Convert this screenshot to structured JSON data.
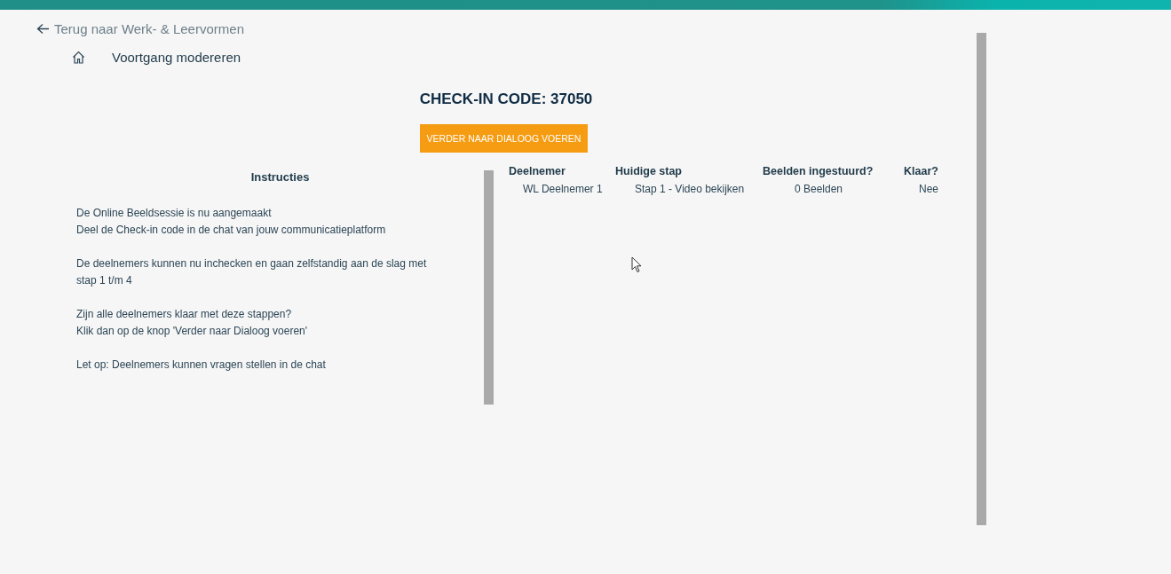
{
  "back_link": {
    "label": "Terug naar Werk- & Leervormen"
  },
  "header": {
    "title": "Voortgang modereren"
  },
  "check_in": {
    "title": "CHECK-IN CODE: 37050"
  },
  "primary_button": {
    "label": "VERDER NAAR DIALOOG VOEREN"
  },
  "instructions": {
    "title": "Instructies",
    "paragraphs": [
      [
        "De Online Beeldsessie is nu aangemaakt",
        "Deel de Check-in code in de chat van jouw communicatieplatform"
      ],
      [
        "De deelnemers kunnen nu inchecken en gaan zelfstandig aan de slag met stap 1 t/m 4"
      ],
      [
        "Zijn alle deelnemers klaar met deze stappen?",
        "Klik dan op de knop 'Verder naar Dialoog voeren'"
      ],
      [
        "Let op: Deelnemers kunnen vragen stellen in de chat"
      ]
    ]
  },
  "table": {
    "columns": [
      "Deelnemer",
      "Huidige stap",
      "Beelden ingestuurd?",
      "Klaar?"
    ],
    "rows": [
      [
        "WL Deelnemer 1",
        "Stap 1 - Video bekijken",
        "0 Beelden",
        "Nee"
      ]
    ]
  }
}
